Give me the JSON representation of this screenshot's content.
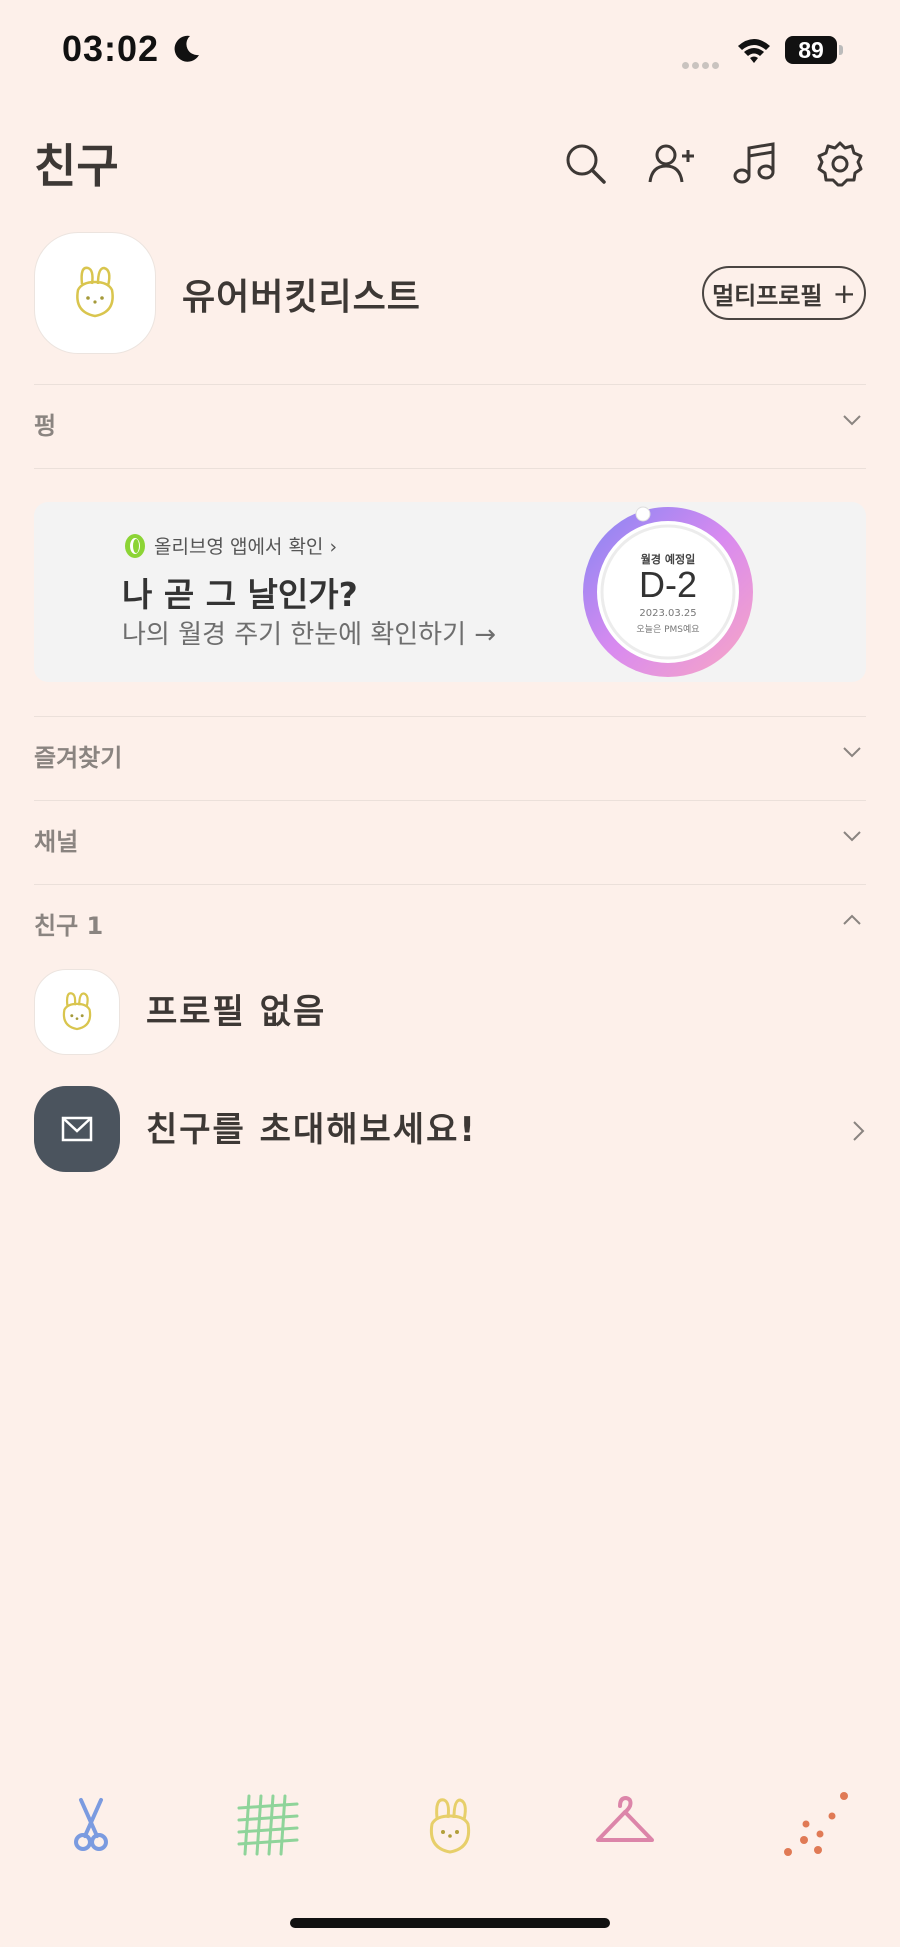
{
  "status_bar": {
    "time": "03:02",
    "battery": "89",
    "icons": [
      "moon-icon",
      "signal-icon",
      "wifi-icon",
      "battery-icon"
    ]
  },
  "header": {
    "title": "친구",
    "icons": [
      "search-icon",
      "add-friend-icon",
      "music-icon",
      "settings-icon"
    ]
  },
  "my_profile": {
    "name": "유어버킷리스트",
    "multi_profile_label": "멀티프로필",
    "multi_profile_icon": "+"
  },
  "sections": {
    "birthday": "펑",
    "favorites": "즐겨찾기",
    "channels": "채널",
    "friends": "친구 1"
  },
  "ad": {
    "brand": "올리브영 앱에서 확인 ›",
    "title": "나 곧 그 날인가?",
    "subtitle": "나의 월경 주기 한눈에 확인하기 →",
    "ring_label": "월경 예정일",
    "ring_value": "D-2",
    "ring_date": "2023.03.25",
    "ring_note": "오늘은 PMS예요",
    "colors": {
      "ring_start": "#8a86f3",
      "ring_mid": "#d88af0",
      "ring_end": "#f7a5c6",
      "leaf": "#8cd435"
    }
  },
  "friends": [
    {
      "name": "프로필 없음",
      "avatar": "bunny-icon"
    },
    {
      "name": "친구를 초대해보세요!",
      "avatar": "mail-icon"
    }
  ],
  "tab_bar": {
    "tabs": [
      "scissors-icon",
      "grid-icon",
      "bunny-icon",
      "hanger-icon",
      "dots-icon"
    ],
    "colors": [
      "#7b9be0",
      "#8fd49a",
      "#e7cf6a",
      "#dc85a9",
      "#e07a55"
    ]
  },
  "theme": {
    "background": "#fdf0ea",
    "text": "#3d3835",
    "muted": "#8a8480"
  }
}
